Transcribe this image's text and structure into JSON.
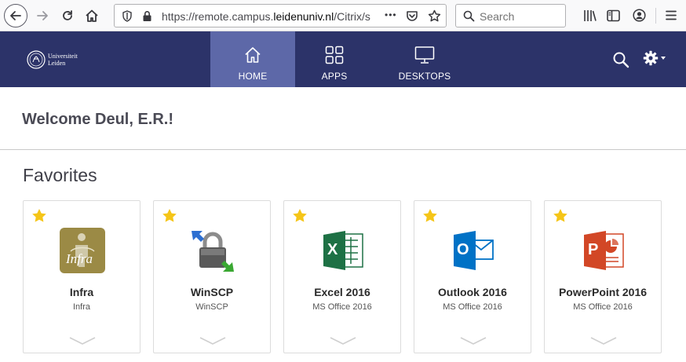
{
  "browser": {
    "url_prefix": "https://remote.campus.",
    "url_domain": "leidenuniv.nl",
    "url_suffix": "/Citrix/s",
    "more_dots": "•••",
    "search_placeholder": "Search"
  },
  "header": {
    "logo_line1": "Universiteit",
    "logo_line2": "Leiden",
    "tabs": [
      {
        "label": "HOME",
        "icon": "home-icon",
        "active": true
      },
      {
        "label": "APPS",
        "icon": "apps-grid-icon",
        "active": false
      },
      {
        "label": "DESKTOPS",
        "icon": "monitor-icon",
        "active": false
      }
    ]
  },
  "welcome": "Welcome Deul, E.R.!",
  "favorites_title": "Favorites",
  "apps": [
    {
      "name": "Infra",
      "sub": "Infra",
      "icon_label": "Infra"
    },
    {
      "name": "WinSCP",
      "sub": "WinSCP"
    },
    {
      "name": "Excel 2016",
      "sub": "MS Office 2016",
      "icon_letter": "X"
    },
    {
      "name": "Outlook 2016",
      "sub": "MS Office 2016",
      "icon_letter": "O"
    },
    {
      "name": "PowerPoint 2016",
      "sub": "MS Office 2016",
      "icon_letter": "P"
    }
  ],
  "colors": {
    "header_bg": "#2c3369",
    "active_tab": "#5d68a8",
    "star": "#f5c518",
    "excel": "#1e7145",
    "outlook": "#0072c6",
    "powerpoint": "#d24726"
  }
}
